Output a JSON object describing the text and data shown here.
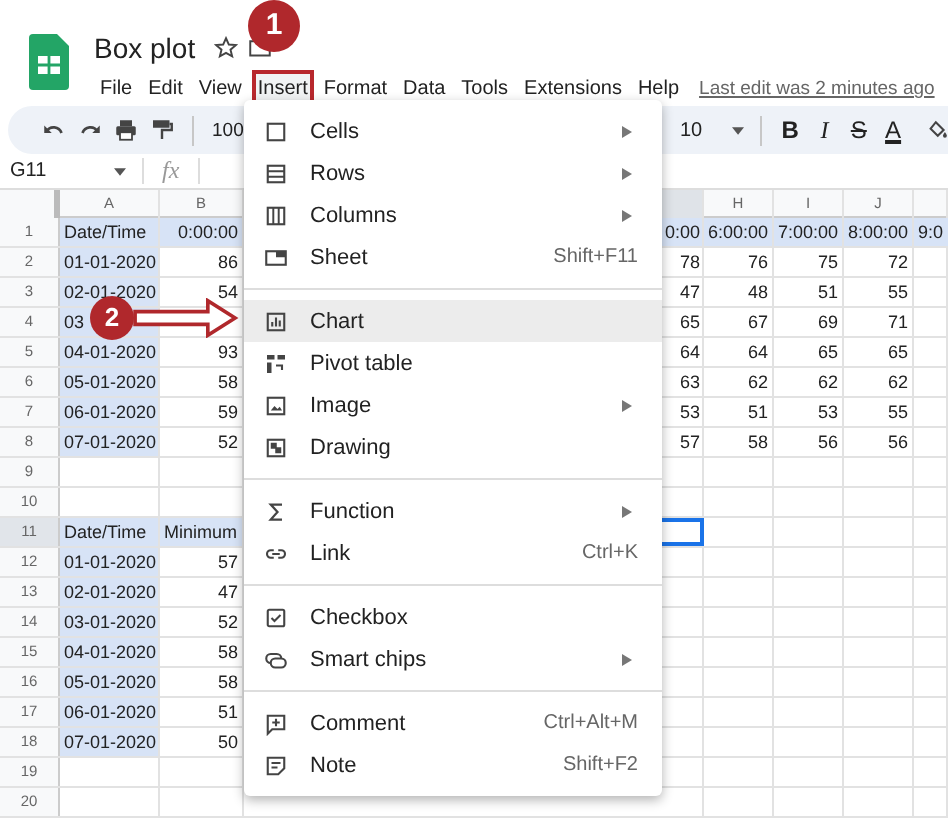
{
  "app": {
    "title": "Box plot",
    "last_edit": "Last edit was 2 minutes ago",
    "menubar": [
      {
        "label": "File",
        "selected": false
      },
      {
        "label": "Edit",
        "selected": false
      },
      {
        "label": "View",
        "selected": false
      },
      {
        "label": "Insert",
        "selected": true
      },
      {
        "label": "Format",
        "selected": false
      },
      {
        "label": "Data",
        "selected": false
      },
      {
        "label": "Tools",
        "selected": false
      },
      {
        "label": "Extensions",
        "selected": false
      },
      {
        "label": "Help",
        "selected": false
      }
    ]
  },
  "toolbar": {
    "zoom": "100",
    "font_size": "10",
    "format_buttons": [
      {
        "kind": "bold",
        "label": "B"
      },
      {
        "kind": "italic",
        "label": "I"
      },
      {
        "kind": "strike",
        "label": "S"
      },
      {
        "kind": "color",
        "label": "A"
      }
    ]
  },
  "formula_bar": {
    "cell_ref": "G11",
    "fx": "fx"
  },
  "sheet": {
    "columns": [
      {
        "header": "A",
        "selected": false
      },
      {
        "header": "B",
        "selected": false
      },
      {
        "selected": true
      },
      {
        "header": "H",
        "selected": false
      },
      {
        "header": "I",
        "selected": false
      },
      {
        "header": "J",
        "selected": false
      },
      {
        "selected": false
      }
    ],
    "rows": [
      {
        "number": "1",
        "kind": "times",
        "selected": false,
        "cells": [
          "Date/Time",
          "0:00:00",
          "0:00",
          "6:00:00",
          "7:00:00",
          "8:00:00",
          "9:0"
        ]
      },
      {
        "number": "2",
        "kind": "data",
        "selected": false,
        "cells": [
          "01-01-2020",
          "86",
          "78",
          "76",
          "75",
          "72"
        ]
      },
      {
        "number": "3",
        "kind": "data",
        "selected": false,
        "cells": [
          "02-01-2020",
          "54",
          "47",
          "48",
          "51",
          "55"
        ]
      },
      {
        "number": "4",
        "kind": "data",
        "selected": false,
        "cells": [
          "03",
          null,
          "65",
          "67",
          "69",
          "71"
        ]
      },
      {
        "number": "5",
        "kind": "data",
        "selected": false,
        "cells": [
          "04-01-2020",
          "93",
          "64",
          "64",
          "65",
          "65"
        ]
      },
      {
        "number": "6",
        "kind": "data",
        "selected": false,
        "cells": [
          "05-01-2020",
          "58",
          "63",
          "62",
          "62",
          "62"
        ]
      },
      {
        "number": "7",
        "kind": "data",
        "selected": false,
        "cells": [
          "06-01-2020",
          "59",
          "53",
          "51",
          "53",
          "55"
        ]
      },
      {
        "number": "8",
        "kind": "data",
        "selected": false,
        "cells": [
          "07-01-2020",
          "52",
          "57",
          "58",
          "56",
          "56"
        ]
      },
      {
        "number": "9",
        "kind": "empty",
        "selected": false
      },
      {
        "number": "10",
        "kind": "empty",
        "selected": false
      },
      {
        "number": "11",
        "kind": "header",
        "selected": true,
        "cells": [
          "Date/Time",
          "Minimum"
        ]
      },
      {
        "number": "12",
        "kind": "data",
        "selected": false,
        "cells": [
          "01-01-2020",
          "57"
        ]
      },
      {
        "number": "13",
        "kind": "data",
        "selected": false,
        "cells": [
          "02-01-2020",
          "47"
        ]
      },
      {
        "number": "14",
        "kind": "data",
        "selected": false,
        "cells": [
          "03-01-2020",
          "52"
        ]
      },
      {
        "number": "15",
        "kind": "data",
        "selected": false,
        "cells": [
          "04-01-2020",
          "58"
        ]
      },
      {
        "number": "16",
        "kind": "data",
        "selected": false,
        "cells": [
          "05-01-2020",
          "58"
        ]
      },
      {
        "number": "17",
        "kind": "data",
        "selected": false,
        "cells": [
          "06-01-2020",
          "51"
        ]
      },
      {
        "number": "18",
        "kind": "data",
        "selected": false,
        "cells": [
          "07-01-2020",
          "50"
        ]
      },
      {
        "number": "19",
        "kind": "empty",
        "selected": false
      },
      {
        "number": "20",
        "kind": "empty",
        "selected": false
      }
    ]
  },
  "menu": {
    "groups": [
      [
        {
          "label": "Cells",
          "submenu": true,
          "highlighted": false
        },
        {
          "label": "Rows",
          "submenu": true,
          "highlighted": false
        },
        {
          "label": "Columns",
          "submenu": true,
          "highlighted": false
        },
        {
          "label": "Sheet",
          "shortcut": "Shift+F11",
          "submenu": false,
          "highlighted": false
        }
      ],
      [
        {
          "label": "Chart",
          "submenu": false,
          "highlighted": true
        },
        {
          "label": "Pivot table",
          "submenu": false,
          "highlighted": false
        },
        {
          "label": "Image",
          "submenu": true,
          "highlighted": false
        },
        {
          "label": "Drawing",
          "submenu": false,
          "highlighted": false
        }
      ],
      [
        {
          "label": "Function",
          "submenu": true,
          "highlighted": false
        },
        {
          "label": "Link",
          "shortcut": "Ctrl+K",
          "submenu": false,
          "highlighted": false
        }
      ],
      [
        {
          "label": "Checkbox",
          "submenu": false,
          "highlighted": false
        },
        {
          "label": "Smart chips",
          "submenu": true,
          "highlighted": false
        }
      ],
      [
        {
          "label": "Comment",
          "shortcut": "Ctrl+Alt+M",
          "submenu": false,
          "highlighted": false
        },
        {
          "label": "Note",
          "shortcut": "Shift+F2",
          "submenu": false,
          "highlighted": false
        }
      ]
    ]
  },
  "annotations": [
    {
      "label": "1"
    },
    {
      "label": "2"
    }
  ]
}
